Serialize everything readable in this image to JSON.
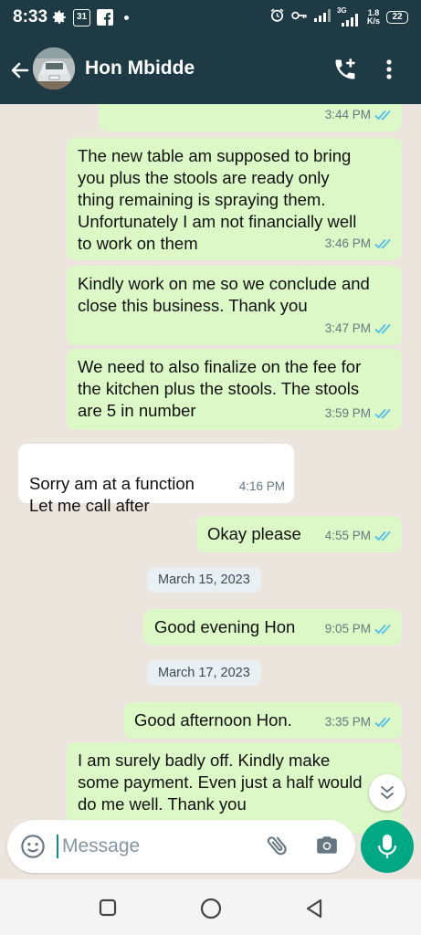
{
  "status_bar": {
    "time": "8:33",
    "calendar_day": "31",
    "network": "3G",
    "speed_value": "1.8",
    "speed_unit": "K/s",
    "battery": "22"
  },
  "header": {
    "contact_name": "Hon Mbidde"
  },
  "messages": [
    {
      "dir": "out",
      "text": "",
      "time": "3:44 PM",
      "status": "read"
    },
    {
      "dir": "out",
      "text": "The new table am supposed to bring you plus the stools are ready only thing remaining is spraying them. Unfortunately I am not financially well to work on them",
      "time": "3:46 PM",
      "status": "read"
    },
    {
      "dir": "out",
      "text": "Kindly work on me so we conclude and close this business. Thank you",
      "time": "3:47 PM",
      "status": "read"
    },
    {
      "dir": "out",
      "text": "We need to also finalize on the fee for the kitchen plus the stools. The stools are 5 in number",
      "time": "3:59 PM",
      "status": "read"
    },
    {
      "dir": "in",
      "text": "Sorry am at a function\nLet me call after",
      "time": "4:16 PM"
    },
    {
      "dir": "out",
      "text": "Okay please",
      "time": "4:55 PM",
      "status": "read"
    },
    {
      "dir": "out",
      "text": "Good evening Hon",
      "time": "9:05 PM",
      "status": "read"
    },
    {
      "dir": "out",
      "text": "Good afternoon Hon.",
      "time": "3:35 PM",
      "status": "read"
    },
    {
      "dir": "out",
      "text": "I am surely badly off. Kindly make some payment. Even just a half would do me well. Thank you",
      "time": "",
      "status": ""
    }
  ],
  "date_separators": [
    "March 15, 2023",
    "March 17, 2023"
  ],
  "composer": {
    "placeholder": "Message"
  },
  "colors": {
    "header": "#1e3a45",
    "outgoing_bubble": "#dcf8c6",
    "incoming_bubble": "#ffffff",
    "chat_background": "#ece5dd",
    "read_ticks": "#53bdeb",
    "mic_button": "#00a884"
  },
  "icons": [
    "settings-icon",
    "calendar-icon",
    "facebook-icon",
    "alarm-icon",
    "key-icon",
    "signal-icon",
    "back-arrow-icon",
    "add-call-icon",
    "more-vert-icon",
    "double-check-icon",
    "scroll-down-icon",
    "emoji-icon",
    "attach-icon",
    "camera-icon",
    "mic-icon",
    "nav-recents-icon",
    "nav-home-icon",
    "nav-back-icon"
  ]
}
